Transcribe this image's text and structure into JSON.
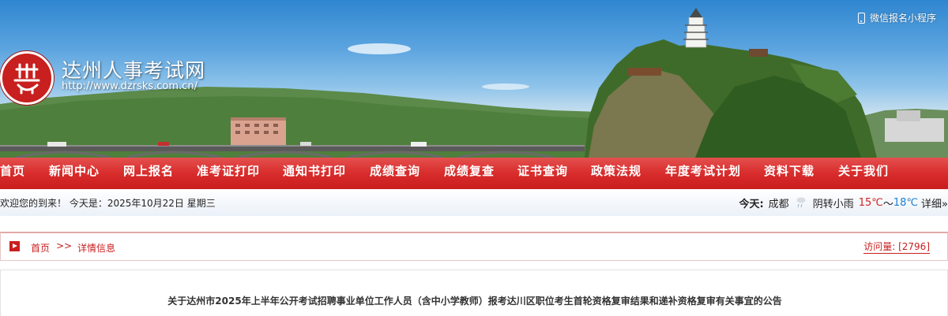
{
  "header": {
    "site_title": "达州人事考试网",
    "site_url": "http://www.dzrsks.com.cn/",
    "wechat_label": "微信报名小程序",
    "brand_color": "#d82d2c"
  },
  "nav": {
    "items": [
      {
        "label": "首页"
      },
      {
        "label": "新闻中心"
      },
      {
        "label": "网上报名"
      },
      {
        "label": "准考证打印"
      },
      {
        "label": "通知书打印"
      },
      {
        "label": "成绩查询"
      },
      {
        "label": "成绩复查"
      },
      {
        "label": "证书查询"
      },
      {
        "label": "政策法规"
      },
      {
        "label": "年度考试计划"
      },
      {
        "label": "资料下载"
      },
      {
        "label": "关于我们"
      }
    ]
  },
  "welcome": {
    "text": "欢迎您的到来！ 今天是：2025年10月22日 星期三"
  },
  "weather": {
    "today_label": "今天:",
    "city": "成都",
    "icon": "light-rain-icon",
    "description": "阴转小雨",
    "low": "15℃",
    "separator": "～",
    "high": "18℃",
    "detail_link": "详细»"
  },
  "breadcrumb": {
    "home": "首页",
    "separator": ">>",
    "current": "详情信息"
  },
  "visits": {
    "text": "访问量: [2796]"
  },
  "article": {
    "title": "关于达州市2025年上半年公开考试招聘事业单位工作人员（含中小学教师）报考达川区职位考生首轮资格复审结果和递补资格复审有关事宜的公告"
  }
}
